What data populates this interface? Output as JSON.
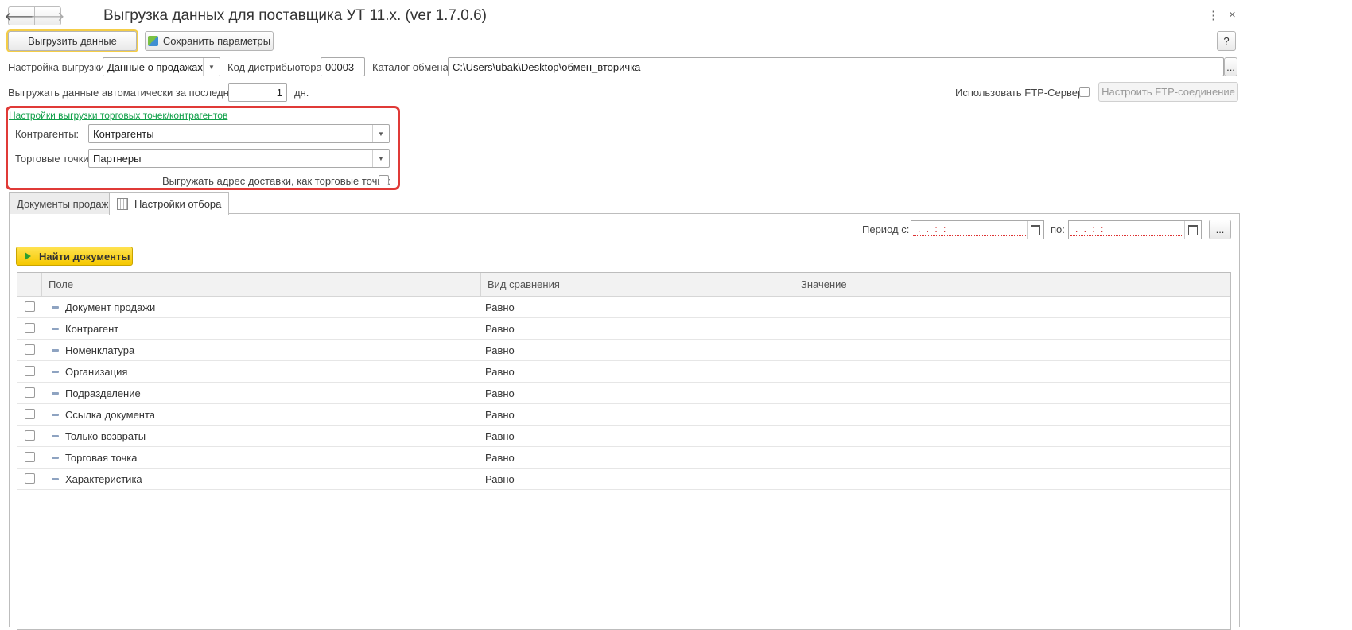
{
  "window": {
    "title": "Выгрузка данных для поставщика УТ 11.x. (ver 1.7.0.6)",
    "more_icon": "⋮",
    "close_icon": "×"
  },
  "toolbar": {
    "upload_label": "Выгрузить данные",
    "save_params_label": "Сохранить параметры",
    "help_label": "?"
  },
  "settings": {
    "export_setting_label": "Настройка выгрузки:",
    "export_setting_value": "Данные о продажах",
    "distributor_code_label": "Код дистрибьютора:",
    "distributor_code_value": "00003",
    "exchange_catalog_label": "Каталог обмена:",
    "exchange_catalog_value": "C:\\Users\\ubak\\Desktop\\обмен_вторичка",
    "browse_label": "...",
    "auto_export_label": "Выгружать данные автоматически за последние:",
    "auto_export_days": "1",
    "days_unit": "дн.",
    "use_ftp_label": "Использовать FTP-Сервер:",
    "ftp_setup_label": "Настроить FTP-соединение"
  },
  "points_settings": {
    "link": "Настройки выгрузки торговых точек/контрагентов",
    "counterparties_label": "Контрагенты:",
    "counterparties_value": "Контрагенты",
    "outlets_label": "Торговые точки:",
    "outlets_value": "Партнеры",
    "delivery_address_label": "Выгружать адрес доставки, как торговые точки:"
  },
  "tabs": [
    {
      "label": "Документы продаж"
    },
    {
      "label": "Настройки отбора"
    }
  ],
  "period": {
    "from_label": "Период с:",
    "to_label": "по:",
    "from_mask": " .  .     :  :",
    "to_mask": " .  .     :  :",
    "extra_label": "..."
  },
  "find_button": "Найти документы",
  "grid": {
    "columns": [
      "Поле",
      "Вид сравнения",
      "Значение"
    ],
    "rows": [
      {
        "field": "Документ продажи",
        "comparison": "Равно",
        "value": ""
      },
      {
        "field": "Контрагент",
        "comparison": "Равно",
        "value": ""
      },
      {
        "field": "Номенклатура",
        "comparison": "Равно",
        "value": ""
      },
      {
        "field": "Организация",
        "comparison": "Равно",
        "value": ""
      },
      {
        "field": "Подразделение",
        "comparison": "Равно",
        "value": ""
      },
      {
        "field": "Ссылка документа",
        "comparison": "Равно",
        "value": ""
      },
      {
        "field": "Только возвраты",
        "comparison": "Равно",
        "value": ""
      },
      {
        "field": "Торговая точка",
        "comparison": "Равно",
        "value": ""
      },
      {
        "field": "Характеристика",
        "comparison": "Равно",
        "value": ""
      }
    ]
  },
  "colors": {
    "accent_yellow": "#f5c800",
    "link_green": "#12a04a",
    "highlight_red": "#e03a37"
  }
}
